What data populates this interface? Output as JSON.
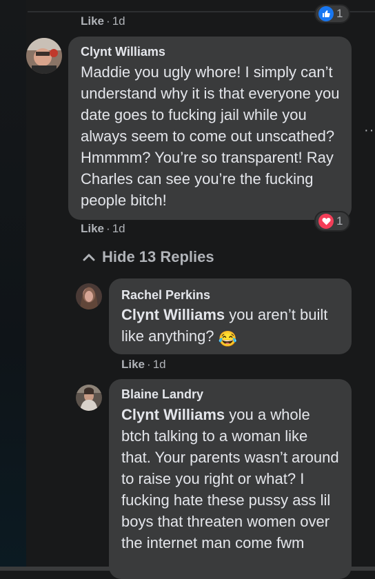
{
  "top_comment": {
    "like_label": "Like",
    "separator": "·",
    "time": "1d",
    "reaction_count": "1"
  },
  "comment": {
    "author": "Clynt Williams",
    "text": "Maddie you ugly whore! I simply can’t understand why it is that everyone you date goes to fucking jail while you always seem to come out unscathed? Hmmmm? You’re so transparent! Ray Charles can see you’re the fucking people bitch!",
    "like_label": "Like",
    "separator": "·",
    "time": "1d",
    "reaction_count": "1",
    "reaction_color": "#f33e58"
  },
  "replies_toggle": {
    "label": "Hide 13 Replies"
  },
  "replies": [
    {
      "author": "Rachel Perkins",
      "mention": "Clynt Williams",
      "text": " you aren’t built like anything?",
      "emoji": "😂",
      "like_label": "Like",
      "separator": "·",
      "time": "1d"
    },
    {
      "author": "Blaine Landry",
      "mention": "Clynt Williams",
      "text": " you a whole btch talking to a woman like that. Your parents wasn’t around to raise you right or what? I fucking hate these pussy ass lil boys that threaten women over the internet man come fwm"
    }
  ],
  "colors": {
    "background": "#18191a",
    "bubble": "#3a3b3c",
    "text": "#e4e6eb",
    "muted": "#b0b3b8",
    "like_blue": "#1877f2"
  }
}
